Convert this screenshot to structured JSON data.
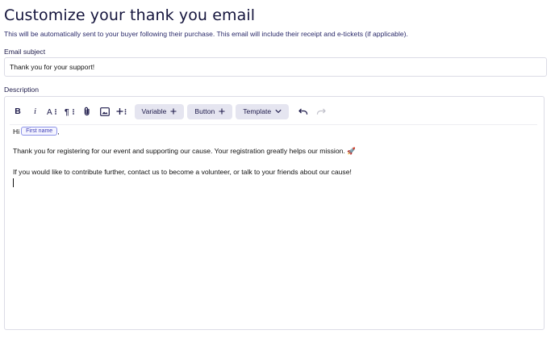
{
  "page": {
    "title": "Customize your thank you email",
    "subtitle": "This will be automatically sent to your buyer following their purchase. This email will include their receipt and e-tickets (if applicable)."
  },
  "subject": {
    "label": "Email subject",
    "value": "Thank you for your support!"
  },
  "description": {
    "label": "Description",
    "toolbar": {
      "bold": "B",
      "italic": "i",
      "text_size_icon": "text-size-icon",
      "paragraph_icon": "paragraph-icon",
      "attachment_icon": "paperclip-icon",
      "image_icon": "image-icon",
      "insert_icon": "insert-icon",
      "variable_label": "Variable",
      "button_label": "Button",
      "template_label": "Template",
      "undo_icon": "undo-icon",
      "redo_icon": "redo-icon"
    },
    "body": {
      "greeting": "Hi",
      "merge_tag": "First name",
      "greeting_suffix": ",",
      "paragraph1": "Thank you for registering for our event and supporting our cause. Your registration greatly helps our mission. 🚀",
      "paragraph2": "If you would like to contribute further, contact us to become a volunteer, or talk to your friends about our cause!"
    }
  },
  "colors": {
    "text_primary": "#1e1b4b",
    "chip_background": "#e5e5f0",
    "merge_tag_border": "#8d93e8",
    "border": "#dcdce6"
  }
}
